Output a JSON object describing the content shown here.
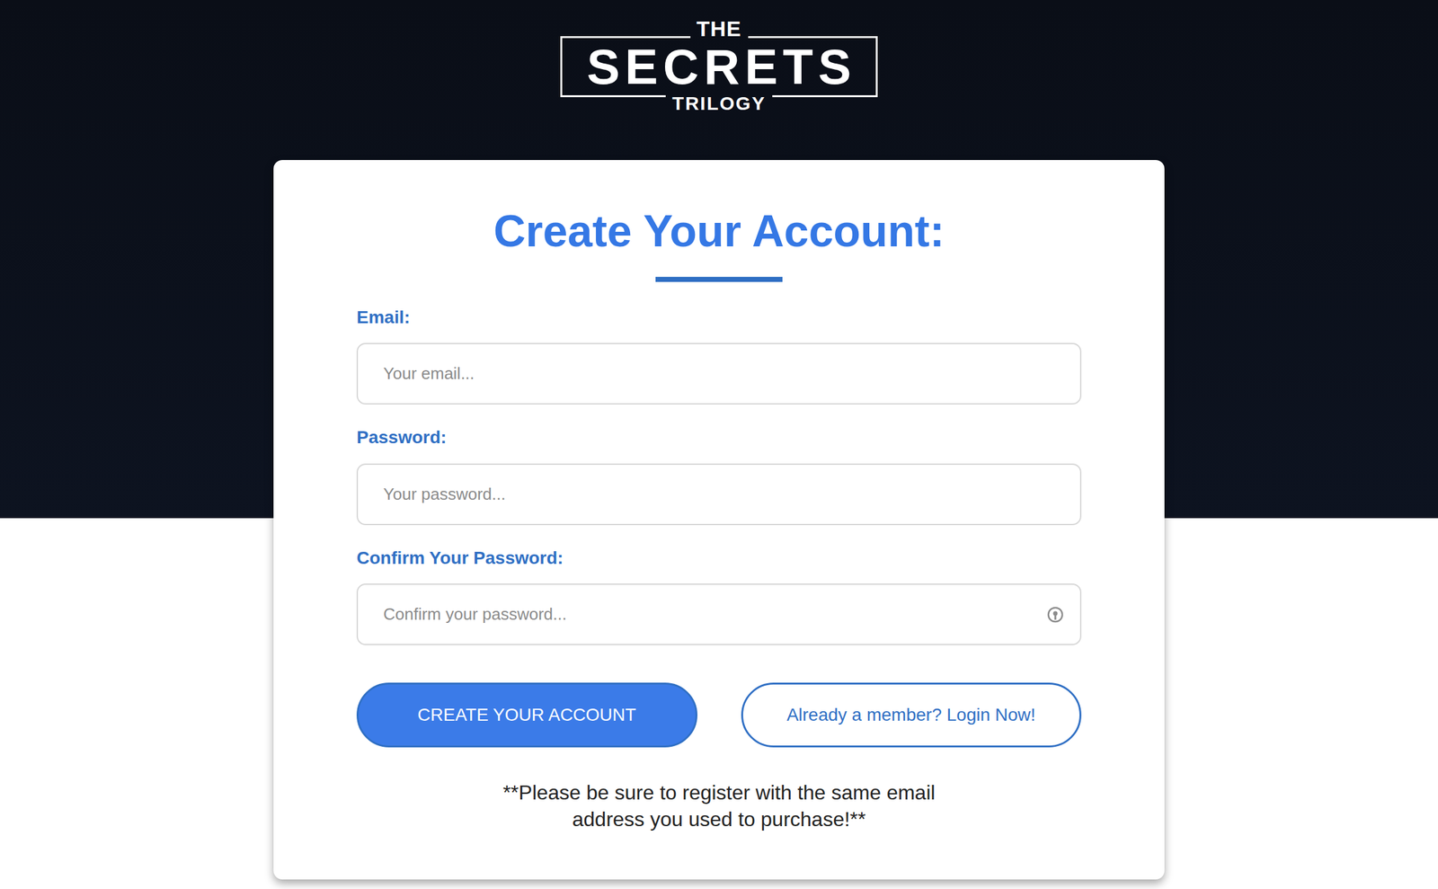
{
  "logo": {
    "top": "THE",
    "main": "SECRETS",
    "bottom": "TRILOGY"
  },
  "form": {
    "title": "Create Your Account:",
    "fields": [
      {
        "label": "Email:",
        "placeholder": "Your email...",
        "autofill_icon": false
      },
      {
        "label": "Password:",
        "placeholder": "Your password...",
        "autofill_icon": false
      },
      {
        "label": "Confirm Your Password:",
        "placeholder": "Confirm your password...",
        "autofill_icon": true
      }
    ],
    "buttons": [
      {
        "label": "CREATE YOUR ACCOUNT",
        "kind": "primary"
      },
      {
        "label": "Already a member? Login Now!",
        "kind": "secondary"
      }
    ],
    "note": "**Please be sure to register with the same email address you used to purchase!**"
  }
}
